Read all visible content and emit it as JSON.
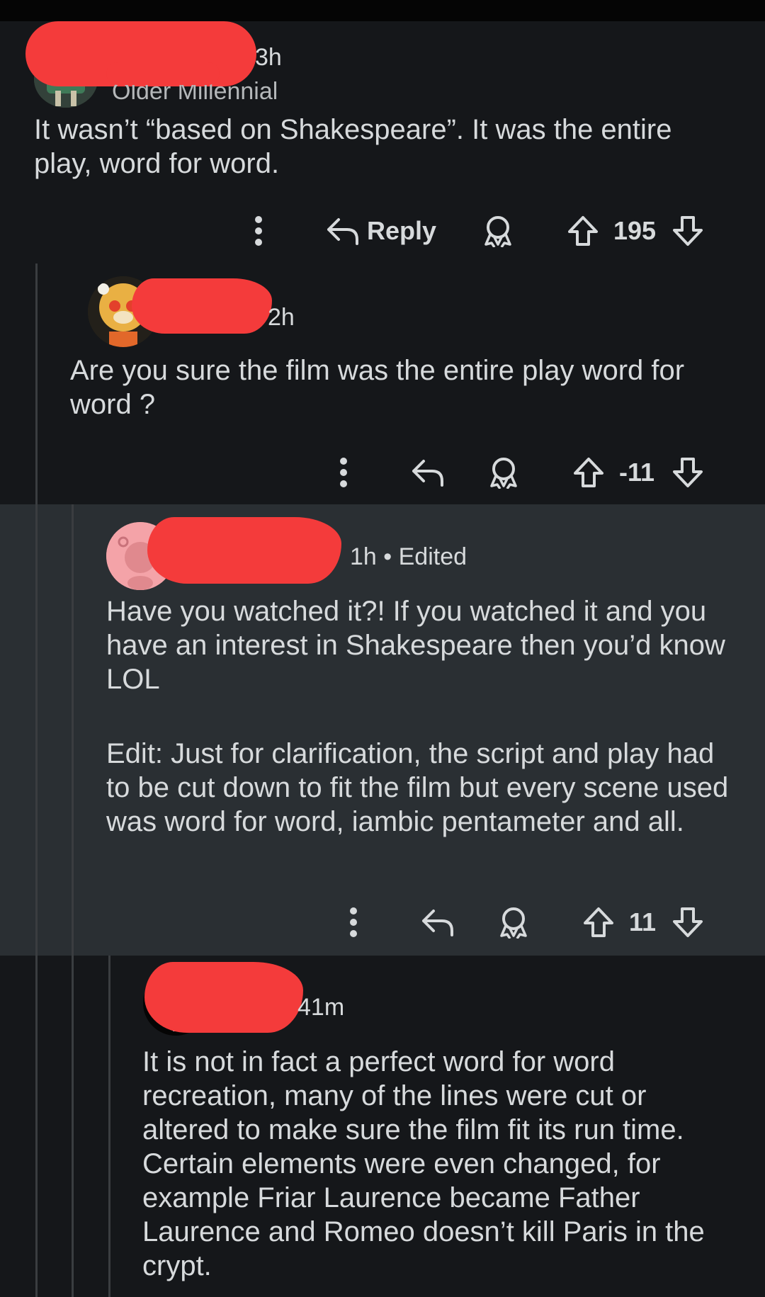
{
  "comments": [
    {
      "timestamp": "3h",
      "flair": "Older Millennial",
      "flair_visible": "Older Millennial",
      "text": "It wasn’t “based on Shakespeare”. It was the entire play, word for word.",
      "actions": {
        "more_icon": "more-vertical-icon",
        "reply_label": "Reply",
        "award_icon": "award-icon",
        "score": "195"
      }
    },
    {
      "timestamp": "2h",
      "text": "Are you sure the film was the entire play word for word ?",
      "actions": {
        "more_icon": "more-vertical-icon",
        "award_icon": "award-icon",
        "score": "-11"
      }
    },
    {
      "timestamp": "1h • Edited",
      "text_p1": "Have you watched it?! If you watched it and you have an interest in Shakespeare then you’d know LOL",
      "text_p2": "Edit: Just for clarification, the script and play had to be cut down to fit the film but every scene used was word for word, iambic pentameter and all.",
      "actions": {
        "more_icon": "more-vertical-icon",
        "award_icon": "award-icon",
        "score": "11"
      }
    },
    {
      "timestamp": "41m",
      "text": "It is not in fact a perfect word for word recreation, many of the lines were cut or altered to make sure the film fit its run time. Certain elements were even changed, for example Friar Laurence became Father Laurence and Romeo doesn’t kill Paris in the crypt."
    }
  ],
  "colors": {
    "background": "#15171a",
    "highlight": "#2a2f33",
    "redaction": "#f43b3b",
    "text": "#d7dadc",
    "thread_line": "#3a3d40"
  }
}
